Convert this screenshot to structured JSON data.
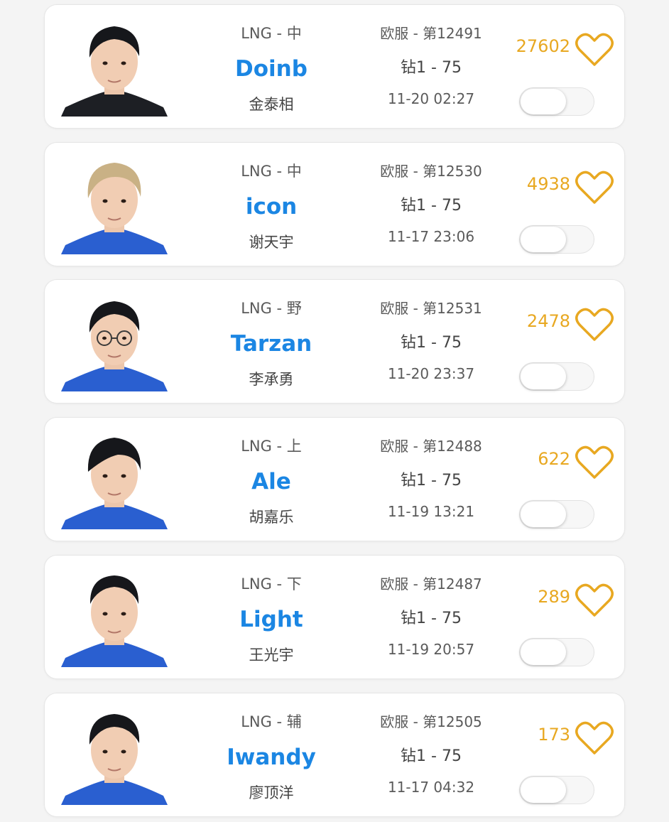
{
  "colors": {
    "accent_blue": "#1b86e3",
    "like_gold": "#e8a821",
    "jersey_blue": "#2a5fd0"
  },
  "players": [
    {
      "team_role": "LNG - 中",
      "name": "Doinb",
      "real_name": "金泰相",
      "server_rank": "欧服 - 第12491",
      "tier": "钻1 - 75",
      "time": "11-20 02:27",
      "likes": "27602",
      "toggle_on": false
    },
    {
      "team_role": "LNG - 中",
      "name": "icon",
      "real_name": "谢天宇",
      "server_rank": "欧服 - 第12530",
      "tier": "钻1 - 75",
      "time": "11-17 23:06",
      "likes": "4938",
      "toggle_on": false
    },
    {
      "team_role": "LNG - 野",
      "name": "Tarzan",
      "real_name": "李承勇",
      "server_rank": "欧服 - 第12531",
      "tier": "钻1 - 75",
      "time": "11-20 23:37",
      "likes": "2478",
      "toggle_on": false
    },
    {
      "team_role": "LNG - 上",
      "name": "Ale",
      "real_name": "胡嘉乐",
      "server_rank": "欧服 - 第12488",
      "tier": "钻1 - 75",
      "time": "11-19 13:21",
      "likes": "622",
      "toggle_on": false
    },
    {
      "team_role": "LNG - 下",
      "name": "Light",
      "real_name": "王光宇",
      "server_rank": "欧服 - 第12487",
      "tier": "钻1 - 75",
      "time": "11-19 20:57",
      "likes": "289",
      "toggle_on": false
    },
    {
      "team_role": "LNG - 辅",
      "name": "Iwandy",
      "real_name": "廖顶洋",
      "server_rank": "欧服 - 第12505",
      "tier": "钻1 - 75",
      "time": "11-17 04:32",
      "likes": "173",
      "toggle_on": false
    }
  ]
}
